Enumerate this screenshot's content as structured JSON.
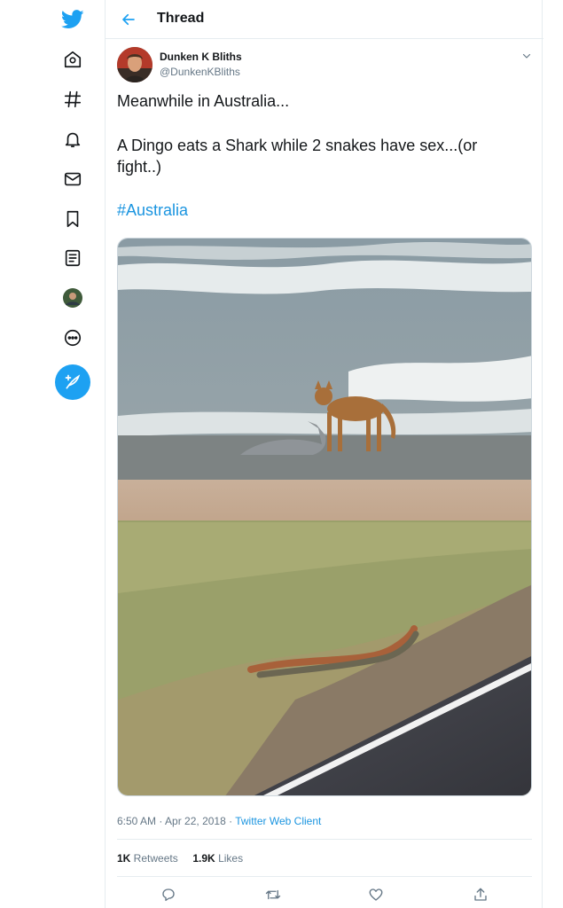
{
  "nav": {
    "items": [
      {
        "icon": "twitter-logo-icon"
      },
      {
        "icon": "home-icon"
      },
      {
        "icon": "explore-hashtag-icon"
      },
      {
        "icon": "notifications-bell-icon"
      },
      {
        "icon": "messages-envelope-icon"
      },
      {
        "icon": "bookmarks-icon"
      },
      {
        "icon": "lists-icon"
      },
      {
        "icon": "profile-avatar-icon"
      },
      {
        "icon": "more-icon"
      }
    ],
    "compose_icon": "compose-tweet-icon"
  },
  "header": {
    "title": "Thread",
    "back_icon": "back-arrow-icon"
  },
  "tweet": {
    "author_name": "Dunken K Bliths",
    "author_handle": "@DunkenKBliths",
    "lines": [
      "Meanwhile in Australia...",
      "A Dingo eats a Shark while 2 snakes have sex...(or",
      "fight..)"
    ],
    "hashtag": "#Australia",
    "time": "6:50 AM",
    "date": "Apr 22, 2018",
    "separator": " · ",
    "client": "Twitter Web Client",
    "retweets_count": "1K",
    "retweets_label": " Retweets",
    "likes_count": "1.9K",
    "likes_label": " Likes"
  },
  "colors": {
    "accent": "#1da1f2",
    "link": "#1b95e0",
    "secondary_text": "#657786",
    "border": "#e6ecf0"
  }
}
